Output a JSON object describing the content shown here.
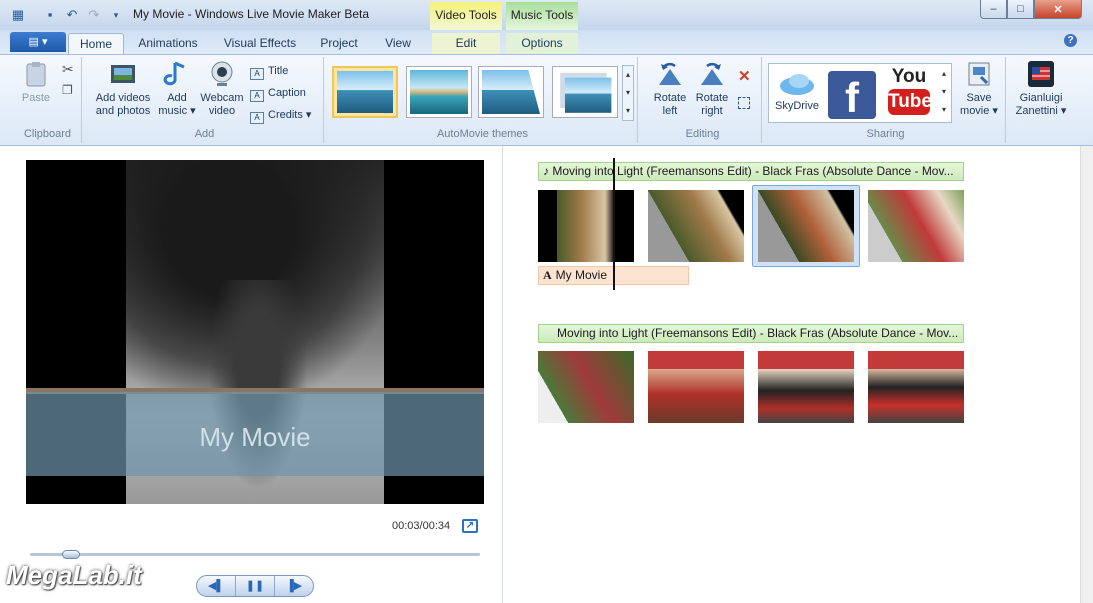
{
  "window": {
    "title": "My Movie - Windows Live Movie Maker Beta",
    "context_tabs": [
      "Video Tools",
      "Music Tools"
    ],
    "controls": {
      "minimize": "–",
      "maximize": "□",
      "close": "✕"
    }
  },
  "qat": {
    "icons": [
      "film-icon",
      "save-icon",
      "undo-icon",
      "redo-icon",
      "customize-icon"
    ]
  },
  "tabs": {
    "app_menu": "▤ ▾",
    "items": [
      "Home",
      "Animations",
      "Visual Effects",
      "Project",
      "View",
      "Edit",
      "Options"
    ]
  },
  "ribbon": {
    "clipboard": {
      "label": "Clipboard",
      "paste": "Paste"
    },
    "add": {
      "label": "Add",
      "add_videos": [
        "Add videos",
        "and photos"
      ],
      "add_music": [
        "Add",
        "music ▾"
      ],
      "webcam": [
        "Webcam",
        "video"
      ],
      "title": "Title",
      "caption": "Caption",
      "credits": "Credits ▾"
    },
    "themes": {
      "label": "AutoMovie themes"
    },
    "editing": {
      "label": "Editing",
      "rotate_left": [
        "Rotate",
        "left"
      ],
      "rotate_right": [
        "Rotate",
        "right"
      ]
    },
    "sharing": {
      "label": "Sharing",
      "skydrive": "SkyDrive",
      "facebook": "f",
      "youtube": [
        "You",
        "Tube"
      ],
      "save_movie": [
        "Save",
        "movie ▾"
      ]
    },
    "user": {
      "name": [
        "Gianluigi",
        "Zanettini ▾"
      ]
    }
  },
  "preview": {
    "caption": "My Movie",
    "time": "00:03/00:34",
    "seek_progress": 0.09,
    "transport": {
      "prev": "◀▌",
      "pause": "❚❚",
      "next": "▐▶"
    }
  },
  "storyboard": {
    "music_1": "♪ Moving into Light (Freemansons Edit) - Black Fras (Absolute Dance - Mov...",
    "music_2": "Moving into Light (Freemansons Edit) - Black Fras (Absolute Dance - Mov...",
    "caption_icon": "A",
    "caption": "My Movie"
  },
  "logo": "MegaLab.it",
  "colors": {
    "accent": "#1f5aa8",
    "video_tools": "#f1ef80",
    "music_tools": "#b2e2a6",
    "caption_bar": "#fde4d1",
    "music_bar": "#d5eec4"
  }
}
